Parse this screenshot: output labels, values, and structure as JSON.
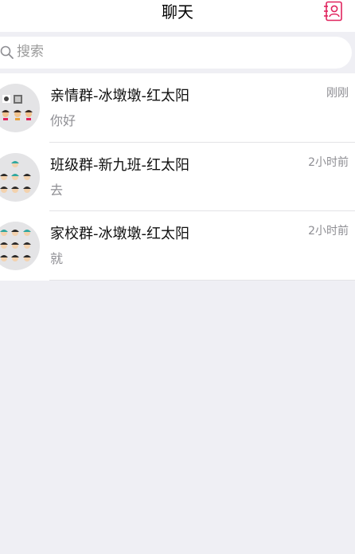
{
  "header": {
    "title": "聊天",
    "contacts_icon": "contacts-book-icon",
    "accent_color": "#e0245e"
  },
  "search": {
    "placeholder": "搜索",
    "icon": "search-icon"
  },
  "chats": [
    {
      "name": "亲情群-冰墩墩-红太阳",
      "time": "刚刚",
      "preview": "你好",
      "avatar": "group-avatar"
    },
    {
      "name": "班级群-新九班-红太阳",
      "time": "2小时前",
      "preview": "去",
      "avatar": "group-avatar"
    },
    {
      "name": "家校群-冰墩墩-红太阳",
      "time": "2小时前",
      "preview": "就",
      "avatar": "group-avatar"
    }
  ]
}
